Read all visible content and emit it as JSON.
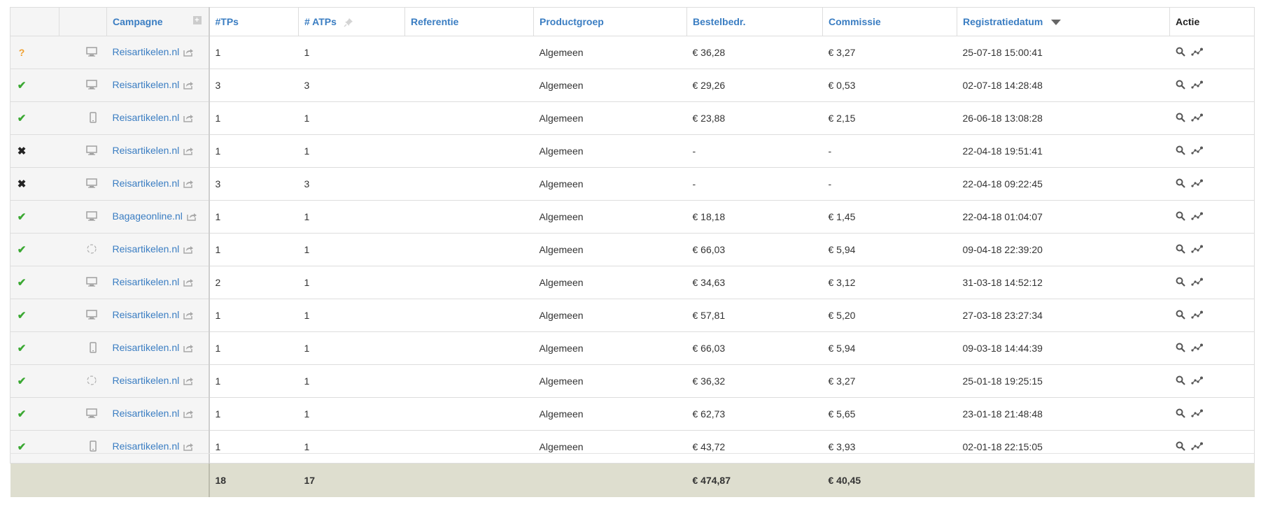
{
  "headers": {
    "status": "",
    "device": "",
    "campagne": "Campagne",
    "tps": "#TPs",
    "atps": "# ATPs",
    "referentie": "Referentie",
    "productgroep": "Productgroep",
    "bestelbedrag": "Bestelbedr.",
    "commissie": "Commissie",
    "registratiedatum": "Registratiedatum",
    "actie": "Actie"
  },
  "rows": [
    {
      "status": "unknown",
      "status_glyph": "?",
      "device": "desktop-icon",
      "campagne": "Reisartikelen.nl",
      "tps": "1",
      "atps": "1",
      "referentie": "",
      "productgroep": "Algemeen",
      "bestelbedrag": "€ 36,28",
      "commissie": "€ 3,27",
      "datum": "25-07-18 15:00:41"
    },
    {
      "status": "approved",
      "status_glyph": "✔",
      "device": "desktop-icon",
      "campagne": "Reisartikelen.nl",
      "tps": "3",
      "atps": "3",
      "referentie": "",
      "productgroep": "Algemeen",
      "bestelbedrag": "€ 29,26",
      "commissie": "€ 0,53",
      "datum": "02-07-18 14:28:48"
    },
    {
      "status": "approved",
      "status_glyph": "✔",
      "device": "mobile-icon",
      "campagne": "Reisartikelen.nl",
      "tps": "1",
      "atps": "1",
      "referentie": "",
      "productgroep": "Algemeen",
      "bestelbedrag": "€ 23,88",
      "commissie": "€ 2,15",
      "datum": "26-06-18 13:08:28"
    },
    {
      "status": "rejected",
      "status_glyph": "✖",
      "device": "desktop-icon",
      "campagne": "Reisartikelen.nl",
      "tps": "1",
      "atps": "1",
      "referentie": "",
      "productgroep": "Algemeen",
      "bestelbedrag": "-",
      "commissie": "-",
      "datum": "22-04-18 19:51:41"
    },
    {
      "status": "rejected",
      "status_glyph": "✖",
      "device": "desktop-icon",
      "campagne": "Reisartikelen.nl",
      "tps": "3",
      "atps": "3",
      "referentie": "",
      "productgroep": "Algemeen",
      "bestelbedrag": "-",
      "commissie": "-",
      "datum": "22-04-18 09:22:45"
    },
    {
      "status": "approved",
      "status_glyph": "✔",
      "device": "desktop-icon",
      "campagne": "Bagageonline.nl",
      "tps": "1",
      "atps": "1",
      "referentie": "",
      "productgroep": "Algemeen",
      "bestelbedrag": "€ 18,18",
      "commissie": "€ 1,45",
      "datum": "22-04-18 01:04:07"
    },
    {
      "status": "approved",
      "status_glyph": "✔",
      "device": "loading-icon",
      "campagne": "Reisartikelen.nl",
      "tps": "1",
      "atps": "1",
      "referentie": "",
      "productgroep": "Algemeen",
      "bestelbedrag": "€ 66,03",
      "commissie": "€ 5,94",
      "datum": "09-04-18 22:39:20"
    },
    {
      "status": "approved",
      "status_glyph": "✔",
      "device": "desktop-icon",
      "campagne": "Reisartikelen.nl",
      "tps": "2",
      "atps": "1",
      "referentie": "",
      "productgroep": "Algemeen",
      "bestelbedrag": "€ 34,63",
      "commissie": "€ 3,12",
      "datum": "31-03-18 14:52:12"
    },
    {
      "status": "approved",
      "status_glyph": "✔",
      "device": "desktop-icon",
      "campagne": "Reisartikelen.nl",
      "tps": "1",
      "atps": "1",
      "referentie": "",
      "productgroep": "Algemeen",
      "bestelbedrag": "€ 57,81",
      "commissie": "€ 5,20",
      "datum": "27-03-18 23:27:34"
    },
    {
      "status": "approved",
      "status_glyph": "✔",
      "device": "mobile-icon",
      "campagne": "Reisartikelen.nl",
      "tps": "1",
      "atps": "1",
      "referentie": "",
      "productgroep": "Algemeen",
      "bestelbedrag": "€ 66,03",
      "commissie": "€ 5,94",
      "datum": "09-03-18 14:44:39"
    },
    {
      "status": "approved",
      "status_glyph": "✔",
      "device": "loading-icon",
      "campagne": "Reisartikelen.nl",
      "tps": "1",
      "atps": "1",
      "referentie": "",
      "productgroep": "Algemeen",
      "bestelbedrag": "€ 36,32",
      "commissie": "€ 3,27",
      "datum": "25-01-18 19:25:15"
    },
    {
      "status": "approved",
      "status_glyph": "✔",
      "device": "desktop-icon",
      "campagne": "Reisartikelen.nl",
      "tps": "1",
      "atps": "1",
      "referentie": "",
      "productgroep": "Algemeen",
      "bestelbedrag": "€ 62,73",
      "commissie": "€ 5,65",
      "datum": "23-01-18 21:48:48"
    },
    {
      "status": "approved",
      "status_glyph": "✔",
      "device": "mobile-icon",
      "campagne": "Reisartikelen.nl",
      "tps": "1",
      "atps": "1",
      "referentie": "",
      "productgroep": "Algemeen",
      "bestelbedrag": "€ 43,72",
      "commissie": "€ 3,93",
      "datum": "02-01-18 22:15:05"
    }
  ],
  "totals": {
    "tps": "18",
    "atps": "17",
    "bestelbedrag": "€ 474,87",
    "commissie": "€ 40,45"
  },
  "colors": {
    "link": "#3a7dc2",
    "approved": "#3aa832",
    "unknown": "#f0a030",
    "rejected": "#222222",
    "footer_bg": "#dedecf"
  },
  "icons": {
    "actions": [
      "search-icon",
      "trend-icon"
    ],
    "link_suffix": "external-link-icon",
    "sort": "sort-desc-icon",
    "pin": "pin-icon",
    "add_column": "plus-icon"
  }
}
